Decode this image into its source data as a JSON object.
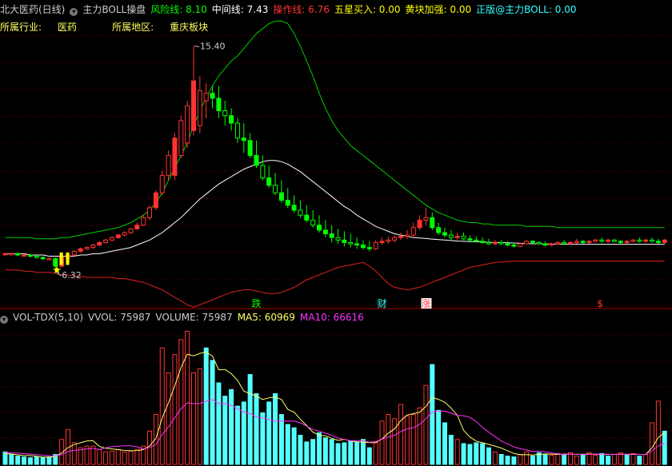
{
  "header": {
    "stock_name": "北大医药(日线)",
    "indicator_name": "主力BOLL操盘",
    "items": [
      {
        "label": "风险线: 8.10",
        "color": "#00ff00"
      },
      {
        "label": "中间线: 7.43",
        "color": "#ffffff"
      },
      {
        "label": "操作线: 6.76",
        "color": "#ff3333"
      },
      {
        "label": "五星买入: 0.00",
        "color": "#ffff00"
      },
      {
        "label": "黄块加强: 0.00",
        "color": "#ffff00"
      },
      {
        "label": "正版@主力BOLL: 0.00",
        "color": "#33ffff"
      }
    ],
    "industry_label": "所属行业:",
    "industry_value": "医药",
    "region_label": "所属地区:",
    "region_value": "重庆板块"
  },
  "volume_header": {
    "name": "VOL-TDX(5,10)",
    "items": [
      {
        "label": "VVOL: 75987",
        "color": "#cccccc"
      },
      {
        "label": "VOLUME: 75987",
        "color": "#cccccc"
      },
      {
        "label": "MA5: 60969",
        "color": "#ffff66"
      },
      {
        "label": "MA10: 66616",
        "color": "#ff33ff"
      }
    ]
  },
  "markers": [
    {
      "text": "跌",
      "bar": 40,
      "color": "#00ff00",
      "bg": ""
    },
    {
      "text": "财",
      "bar": 60,
      "color": "#33ffff",
      "bg": ""
    },
    {
      "text": "涨",
      "bar": 67,
      "color": "#ff3333",
      "bg": "#ffffff"
    },
    {
      "text": "$",
      "bar": 95,
      "color": "#ff3333",
      "bg": ""
    }
  ],
  "colors": {
    "up": "#ff3333",
    "down": "#00ff00",
    "vol_up": "#ff3333",
    "vol_down": "#55ffff",
    "upper_band": "#00cc00",
    "middle_band": "#ffffff",
    "lower_band": "#dd2222",
    "grid": "#7a0000",
    "ma5": "#ffff66",
    "ma10": "#ff33ff",
    "star": "#ffff00"
  },
  "chart_data": {
    "type": "candlestick",
    "price_range": [
      5.2,
      16.8
    ],
    "volume_range": [
      0,
      170000
    ],
    "annotations": [
      {
        "text": "15.40",
        "bar": 30,
        "value": 15.4
      },
      {
        "text": "6.32",
        "bar": 8,
        "value": 6.32
      }
    ],
    "candles": [
      [
        7.05,
        7.1,
        7.0,
        7.05
      ],
      [
        7.05,
        7.1,
        7.0,
        7.05
      ],
      [
        7.05,
        7.1,
        6.95,
        7.0
      ],
      [
        7.0,
        7.05,
        6.95,
        7.0
      ],
      [
        7.0,
        7.05,
        6.9,
        6.95
      ],
      [
        6.95,
        7.0,
        6.85,
        6.9
      ],
      [
        6.9,
        6.95,
        6.8,
        6.85
      ],
      [
        6.85,
        6.9,
        6.8,
        6.85
      ],
      [
        6.85,
        6.9,
        6.32,
        6.55
      ],
      [
        6.55,
        6.95,
        6.5,
        6.9
      ],
      [
        6.9,
        7.05,
        6.85,
        7.0
      ],
      [
        7.0,
        7.2,
        6.95,
        7.15
      ],
      [
        7.15,
        7.3,
        7.1,
        7.25
      ],
      [
        7.25,
        7.35,
        7.2,
        7.3
      ],
      [
        7.3,
        7.45,
        7.25,
        7.4
      ],
      [
        7.4,
        7.55,
        7.35,
        7.5
      ],
      [
        7.5,
        7.65,
        7.45,
        7.6
      ],
      [
        7.6,
        7.75,
        7.55,
        7.7
      ],
      [
        7.7,
        7.85,
        7.65,
        7.8
      ],
      [
        7.8,
        7.95,
        7.75,
        7.9
      ],
      [
        7.9,
        8.1,
        7.85,
        8.05
      ],
      [
        8.05,
        8.3,
        8.0,
        8.2
      ],
      [
        8.2,
        8.6,
        8.15,
        8.5
      ],
      [
        8.5,
        9.0,
        8.4,
        8.9
      ],
      [
        8.9,
        9.6,
        8.8,
        9.5
      ],
      [
        9.5,
        10.4,
        9.4,
        10.2
      ],
      [
        10.2,
        11.2,
        10.0,
        11.0
      ],
      [
        10.2,
        11.9,
        10.0,
        11.7
      ],
      [
        11.0,
        12.6,
        10.9,
        12.4
      ],
      [
        11.5,
        13.2,
        11.3,
        13.0
      ],
      [
        12.0,
        15.4,
        11.8,
        14.0
      ],
      [
        12.2,
        14.2,
        11.9,
        13.6
      ],
      [
        13.2,
        13.9,
        12.5,
        13.5
      ],
      [
        13.5,
        13.8,
        12.9,
        13.3
      ],
      [
        13.3,
        13.8,
        12.5,
        12.8
      ],
      [
        12.8,
        13.2,
        12.2,
        12.6
      ],
      [
        12.6,
        12.9,
        12.0,
        12.3
      ],
      [
        12.3,
        12.5,
        11.5,
        11.7
      ],
      [
        11.7,
        12.3,
        11.1,
        11.6
      ],
      [
        11.6,
        11.9,
        10.9,
        11.0
      ],
      [
        11.0,
        11.6,
        10.5,
        10.6
      ],
      [
        10.6,
        11.0,
        10.0,
        10.1
      ],
      [
        10.1,
        10.6,
        9.7,
        9.8
      ],
      [
        9.8,
        10.3,
        9.4,
        9.5
      ],
      [
        9.5,
        10.0,
        9.1,
        9.2
      ],
      [
        9.2,
        9.7,
        8.9,
        9.0
      ],
      [
        9.0,
        9.4,
        8.7,
        8.8
      ],
      [
        8.8,
        9.2,
        8.5,
        8.6
      ],
      [
        8.6,
        9.0,
        8.3,
        8.4
      ],
      [
        8.4,
        8.8,
        8.1,
        8.2
      ],
      [
        8.2,
        8.6,
        7.9,
        8.0
      ],
      [
        8.0,
        8.4,
        7.7,
        7.85
      ],
      [
        7.85,
        8.2,
        7.5,
        7.7
      ],
      [
        7.7,
        8.05,
        7.45,
        7.6
      ],
      [
        7.6,
        7.95,
        7.35,
        7.5
      ],
      [
        7.5,
        7.85,
        7.3,
        7.45
      ],
      [
        7.45,
        7.7,
        7.25,
        7.4
      ],
      [
        7.4,
        7.6,
        7.2,
        7.3
      ],
      [
        7.3,
        7.55,
        7.15,
        7.25
      ],
      [
        7.25,
        7.6,
        7.2,
        7.5
      ],
      [
        7.5,
        7.7,
        7.4,
        7.55
      ],
      [
        7.55,
        7.75,
        7.45,
        7.6
      ],
      [
        7.6,
        7.8,
        7.5,
        7.7
      ],
      [
        7.7,
        7.9,
        7.6,
        7.75
      ],
      [
        7.75,
        8.0,
        7.65,
        7.8
      ],
      [
        7.8,
        8.3,
        7.7,
        8.1
      ],
      [
        8.1,
        8.6,
        8.0,
        8.4
      ],
      [
        8.4,
        8.9,
        8.2,
        8.5
      ],
      [
        8.5,
        8.7,
        8.0,
        8.1
      ],
      [
        8.1,
        8.3,
        7.8,
        7.9
      ],
      [
        7.9,
        8.1,
        7.7,
        7.8
      ],
      [
        7.8,
        8.0,
        7.6,
        7.7
      ],
      [
        7.7,
        7.9,
        7.6,
        7.75
      ],
      [
        7.75,
        7.9,
        7.6,
        7.65
      ],
      [
        7.65,
        7.8,
        7.5,
        7.6
      ],
      [
        7.6,
        7.75,
        7.5,
        7.55
      ],
      [
        7.55,
        7.7,
        7.45,
        7.5
      ],
      [
        7.5,
        7.65,
        7.4,
        7.45
      ],
      [
        7.45,
        7.6,
        7.4,
        7.5
      ],
      [
        7.5,
        7.6,
        7.4,
        7.45
      ],
      [
        7.45,
        7.55,
        7.35,
        7.4
      ],
      [
        7.4,
        7.5,
        7.3,
        7.35
      ],
      [
        7.35,
        7.5,
        7.3,
        7.45
      ],
      [
        7.45,
        7.6,
        7.4,
        7.55
      ],
      [
        7.55,
        7.6,
        7.45,
        7.5
      ],
      [
        7.5,
        7.55,
        7.4,
        7.45
      ],
      [
        7.45,
        7.55,
        7.35,
        7.4
      ],
      [
        7.4,
        7.5,
        7.35,
        7.45
      ],
      [
        7.45,
        7.55,
        7.4,
        7.5
      ],
      [
        7.5,
        7.6,
        7.4,
        7.45
      ],
      [
        7.45,
        7.55,
        7.4,
        7.5
      ],
      [
        7.5,
        7.65,
        7.45,
        7.55
      ],
      [
        7.55,
        7.6,
        7.45,
        7.5
      ],
      [
        7.5,
        7.6,
        7.45,
        7.55
      ],
      [
        7.55,
        7.65,
        7.5,
        7.6
      ],
      [
        7.6,
        7.7,
        7.5,
        7.55
      ],
      [
        7.55,
        7.65,
        7.5,
        7.6
      ],
      [
        7.6,
        7.65,
        7.5,
        7.55
      ],
      [
        7.55,
        7.6,
        7.45,
        7.5
      ],
      [
        7.5,
        7.6,
        7.45,
        7.55
      ],
      [
        7.55,
        7.65,
        7.5,
        7.6
      ],
      [
        7.6,
        7.7,
        7.5,
        7.55
      ],
      [
        7.55,
        7.65,
        7.5,
        7.6
      ],
      [
        7.6,
        7.7,
        7.5,
        7.55
      ],
      [
        7.55,
        7.65,
        7.45,
        7.5
      ],
      [
        7.5,
        7.65,
        7.45,
        7.6
      ]
    ],
    "upper_band": [
      7.7,
      7.7,
      7.7,
      7.7,
      7.7,
      7.65,
      7.65,
      7.65,
      7.65,
      7.7,
      7.7,
      7.75,
      7.8,
      7.85,
      7.9,
      7.95,
      8.0,
      8.05,
      8.1,
      8.2,
      8.3,
      8.45,
      8.6,
      8.8,
      9.1,
      9.5,
      10.0,
      10.5,
      11.0,
      11.5,
      12.2,
      12.8,
      13.3,
      13.8,
      14.2,
      14.5,
      14.8,
      15.0,
      15.3,
      15.6,
      15.9,
      16.1,
      16.3,
      16.4,
      16.4,
      16.3,
      15.9,
      15.4,
      14.8,
      14.2,
      13.5,
      12.9,
      12.4,
      12.0,
      11.7,
      11.4,
      11.2,
      11.0,
      10.8,
      10.6,
      10.4,
      10.2,
      10.0,
      9.8,
      9.6,
      9.4,
      9.2,
      9.0,
      8.85,
      8.7,
      8.6,
      8.5,
      8.4,
      8.35,
      8.3,
      8.3,
      8.25,
      8.25,
      8.2,
      8.2,
      8.2,
      8.2,
      8.2,
      8.15,
      8.15,
      8.15,
      8.15,
      8.15,
      8.1,
      8.1,
      8.1,
      8.1,
      8.1,
      8.1,
      8.1,
      8.1,
      8.1,
      8.1,
      8.1,
      8.1,
      8.1,
      8.1,
      8.1,
      8.1,
      8.1,
      8.1
    ],
    "middle_band": [
      7.05,
      7.05,
      7.05,
      7.05,
      7.0,
      7.0,
      7.0,
      6.95,
      6.95,
      6.95,
      6.95,
      6.95,
      7.0,
      7.0,
      7.05,
      7.05,
      7.1,
      7.15,
      7.2,
      7.25,
      7.3,
      7.4,
      7.5,
      7.6,
      7.75,
      7.9,
      8.1,
      8.3,
      8.5,
      8.75,
      9.0,
      9.25,
      9.45,
      9.65,
      9.85,
      10.0,
      10.15,
      10.3,
      10.45,
      10.55,
      10.65,
      10.75,
      10.8,
      10.8,
      10.75,
      10.65,
      10.5,
      10.35,
      10.15,
      9.95,
      9.75,
      9.55,
      9.35,
      9.15,
      8.95,
      8.8,
      8.6,
      8.45,
      8.3,
      8.15,
      8.05,
      7.95,
      7.85,
      7.8,
      7.75,
      7.7,
      7.68,
      7.66,
      7.64,
      7.62,
      7.6,
      7.58,
      7.56,
      7.55,
      7.54,
      7.53,
      7.52,
      7.51,
      7.5,
      7.5,
      7.49,
      7.48,
      7.47,
      7.46,
      7.45,
      7.45,
      7.44,
      7.44,
      7.44,
      7.43,
      7.43,
      7.43,
      7.43,
      7.43,
      7.43,
      7.43,
      7.43,
      7.43,
      7.43,
      7.43,
      7.43,
      7.43,
      7.43,
      7.43,
      7.43,
      7.43
    ],
    "lower_band": [
      6.4,
      6.4,
      6.4,
      6.35,
      6.35,
      6.3,
      6.3,
      6.3,
      6.25,
      6.2,
      6.2,
      6.15,
      6.15,
      6.1,
      6.1,
      6.1,
      6.1,
      6.1,
      6.05,
      6.05,
      6.0,
      5.95,
      5.9,
      5.8,
      5.7,
      5.6,
      5.45,
      5.3,
      5.15,
      5.0,
      4.9,
      5.0,
      5.1,
      5.2,
      5.3,
      5.4,
      5.5,
      5.55,
      5.6,
      5.6,
      5.55,
      5.5,
      5.45,
      5.45,
      5.5,
      5.6,
      5.7,
      5.85,
      6.0,
      6.1,
      6.2,
      6.3,
      6.4,
      6.5,
      6.55,
      6.6,
      6.65,
      6.7,
      6.55,
      6.35,
      6.1,
      5.85,
      5.7,
      5.65,
      5.6,
      5.65,
      5.7,
      5.8,
      5.9,
      6.0,
      6.1,
      6.2,
      6.3,
      6.4,
      6.5,
      6.55,
      6.6,
      6.65,
      6.7,
      6.72,
      6.74,
      6.75,
      6.76,
      6.76,
      6.76,
      6.76,
      6.76,
      6.76,
      6.76,
      6.76,
      6.76,
      6.76,
      6.76,
      6.76,
      6.76,
      6.76,
      6.76,
      6.76,
      6.76,
      6.76,
      6.76,
      6.76,
      6.76,
      6.76,
      6.76,
      6.76
    ],
    "volume": [
      15000,
      12000,
      10000,
      9000,
      8000,
      9000,
      8500,
      9000,
      12000,
      30000,
      42000,
      26000,
      20000,
      22000,
      22000,
      18000,
      15000,
      16000,
      18000,
      15000,
      16000,
      18000,
      22000,
      40000,
      60000,
      140000,
      110000,
      132000,
      150000,
      160000,
      110000,
      115000,
      140000,
      125000,
      98000,
      82000,
      90000,
      70000,
      75000,
      108000,
      85000,
      62000,
      75000,
      85000,
      60000,
      48000,
      44000,
      35000,
      27000,
      30000,
      38000,
      32000,
      30000,
      25000,
      26000,
      28000,
      27000,
      30000,
      20000,
      26000,
      52000,
      60000,
      55000,
      72000,
      58000,
      60000,
      68000,
      95000,
      120000,
      65000,
      50000,
      35000,
      30000,
      25000,
      24000,
      26000,
      25000,
      20000,
      15000,
      12000,
      10000,
      9000,
      12000,
      15000,
      10000,
      14000,
      12000,
      11000,
      13000,
      12000,
      14000,
      10000,
      12000,
      14000,
      11000,
      13000,
      10000,
      12000,
      14000,
      11000,
      13000,
      10000,
      12000,
      50000,
      75987,
      40000
    ],
    "vol_up": [
      0,
      0,
      0,
      0,
      0,
      0,
      0,
      0,
      0,
      1,
      1,
      1,
      1,
      1,
      1,
      1,
      1,
      1,
      1,
      1,
      1,
      1,
      1,
      1,
      1,
      1,
      1,
      1,
      1,
      1,
      1,
      1,
      0,
      0,
      0,
      0,
      0,
      0,
      0,
      0,
      0,
      0,
      0,
      0,
      0,
      0,
      0,
      0,
      0,
      0,
      0,
      0,
      0,
      0,
      0,
      0,
      0,
      0,
      0,
      1,
      1,
      1,
      1,
      1,
      1,
      1,
      1,
      1,
      0,
      0,
      0,
      0,
      1,
      0,
      0,
      0,
      0,
      0,
      1,
      0,
      0,
      0,
      1,
      1,
      0,
      0,
      0,
      1,
      1,
      0,
      1,
      1,
      0,
      1,
      1,
      0,
      0,
      1,
      1,
      0,
      1,
      0,
      1,
      1,
      1,
      0
    ],
    "ma5": [
      13000,
      12500,
      11500,
      10800,
      10600,
      9700,
      8700,
      8700,
      9300,
      13700,
      20300,
      23800,
      26000,
      28000,
      28400,
      21600,
      19400,
      18600,
      17800,
      16800,
      16400,
      16600,
      17800,
      22200,
      31200,
      56000,
      74000,
      94400,
      116400,
      132400,
      130400,
      133400,
      135000,
      130000,
      113600,
      114000,
      109000,
      101000,
      88000,
      85000,
      82000,
      78000,
      80000,
      81000,
      78000,
      66000,
      62800,
      54400,
      46600,
      38800,
      34800,
      34400,
      31400,
      28800,
      30200,
      28200,
      27200,
      26800,
      26200,
      26200,
      30600,
      37600,
      42600,
      52600,
      59400,
      61000,
      62600,
      69600,
      80200,
      78200,
      74600,
      67600,
      59000,
      41000,
      32800,
      28000,
      26000,
      24000,
      22000,
      19600,
      16400,
      13200,
      11600,
      11800,
      11200,
      12000,
      12600,
      12400,
      12000,
      12400,
      12400,
      12000,
      12200,
      12400,
      12200,
      12000,
      12000,
      12000,
      12200,
      12000,
      12200,
      12000,
      12000,
      20000,
      32400,
      38400
    ],
    "ma10": [
      14000,
      13800,
      13500,
      13000,
      12500,
      11800,
      11000,
      10500,
      10200,
      11700,
      15500,
      17000,
      17500,
      18600,
      19200,
      17800,
      19900,
      21200,
      21900,
      22400,
      22400,
      21100,
      18500,
      20400,
      24000,
      36000,
      45000,
      56000,
      67000,
      74000,
      73000,
      73000,
      76000,
      78000,
      73000,
      73000,
      71000,
      67000,
      63000,
      61000,
      57000,
      56000,
      54000,
      52000,
      52000,
      52000,
      52000,
      50000,
      46000,
      42000,
      40000,
      37500,
      35000,
      31700,
      30000,
      28400,
      28700,
      28300,
      26700,
      27400,
      30300,
      32900,
      35100,
      39400,
      42700,
      44000,
      48200,
      55000,
      63000,
      64000,
      64000,
      61500,
      58900,
      58500,
      56500,
      51500,
      44600,
      38700,
      33400,
      28000,
      24600,
      21000,
      18800,
      17400,
      15400,
      15800,
      15000,
      13800,
      12800,
      11600,
      12400,
      12300,
      11900,
      12000,
      12300,
      12300,
      12200,
      12100,
      12200,
      12200,
      12300,
      12000,
      12100,
      16300,
      22200,
      25200
    ]
  }
}
